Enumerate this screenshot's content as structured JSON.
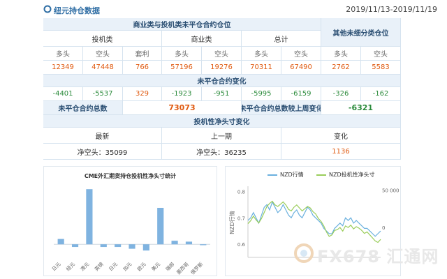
{
  "header": {
    "title": "纽元持仓数据",
    "date_range": "2019/11/13-2019/11/19"
  },
  "table": {
    "section_nonreport_title": "商业类与投机类未平仓合约仓位",
    "section_other_title": "其他未细分类仓位",
    "groups": [
      "投机类",
      "商业类",
      "总计"
    ],
    "cols": [
      "多头",
      "空头",
      "套利",
      "多头",
      "空头",
      "多头",
      "空头",
      "多头",
      "空头"
    ],
    "values": [
      "12349",
      "47448",
      "766",
      "57196",
      "19276",
      "70311",
      "67490",
      "2762",
      "5583"
    ],
    "change_title": "未平仓合约变化",
    "changes": [
      "-4401",
      "-5537",
      "329",
      "-1923",
      "-951",
      "-5995",
      "-6159",
      "-326",
      "-162"
    ],
    "total_label": "未平仓合约总数",
    "total_value": "73073",
    "weekly_label": "未平仓合约总数较上周变化",
    "weekly_value": "-6321",
    "net_title": "投机性净头寸变化",
    "net_cols": [
      "最新",
      "上一期",
      "变化"
    ],
    "net_latest": "净空头：35099",
    "net_prev": "净空头：36235",
    "net_change": "1136"
  },
  "chart_data": [
    {
      "type": "bar",
      "title": "CME外汇期货持仓投机性净头寸统计",
      "categories": [
        "日元",
        "纽元",
        "澳元",
        "英镑",
        "日元",
        "加元",
        "欧元",
        "美元",
        "瑞郎",
        "墨西哥",
        "俄罗斯"
      ],
      "values": [
        6,
        -3,
        62,
        -3,
        -3,
        -5,
        -7,
        41,
        4,
        3,
        -1
      ],
      "ylim": [
        -10,
        70
      ],
      "grid": false,
      "color": "#7fb3e0"
    },
    {
      "type": "line",
      "ylabel": "NZD行情",
      "y_left_ticks": [
        "0.8",
        "0.7",
        "0.6"
      ],
      "y_right_ticks": [
        "50 000",
        "0"
      ],
      "series": [
        {
          "name": "NZD行情",
          "color": "#6ab0de",
          "values": [
            0.69,
            0.7,
            0.72,
            0.7,
            0.68,
            0.71,
            0.74,
            0.75,
            0.73,
            0.76,
            0.74,
            0.72,
            0.73,
            0.75,
            0.73,
            0.71,
            0.7,
            0.72,
            0.73,
            0.71,
            0.7,
            0.72,
            0.74,
            0.73,
            0.71,
            0.7,
            0.69,
            0.68,
            0.66,
            0.65,
            0.64,
            0.64,
            0.66,
            0.67,
            0.68,
            0.67,
            0.7,
            0.69,
            0.7,
            0.68,
            0.69,
            0.68,
            0.67,
            0.66,
            0.66,
            0.65,
            0.64,
            0.63,
            0.64,
            0.65
          ]
        },
        {
          "name": "NZD投机性净头寸",
          "color": "#9acd5a",
          "values": [
            5000,
            9000,
            15000,
            10000,
            6000,
            12000,
            20000,
            28000,
            32000,
            35000,
            30000,
            28000,
            31000,
            34000,
            30000,
            24000,
            22000,
            27000,
            30000,
            26000,
            22000,
            25000,
            28000,
            26000,
            21000,
            18000,
            12000,
            8000,
            2000,
            -6000,
            -12000,
            -10000,
            -4000,
            -3000,
            0,
            -5000,
            2000,
            0,
            3000,
            -2000,
            1000,
            -1000,
            -4000,
            -8000,
            -6000,
            -10000,
            -14000,
            -18000,
            -20000,
            -16000
          ]
        }
      ],
      "y_left_range": [
        0.55,
        0.82
      ],
      "y_right_range": [
        -40000,
        55000
      ]
    }
  ],
  "watermark": {
    "text": "FX678 汇通网"
  }
}
